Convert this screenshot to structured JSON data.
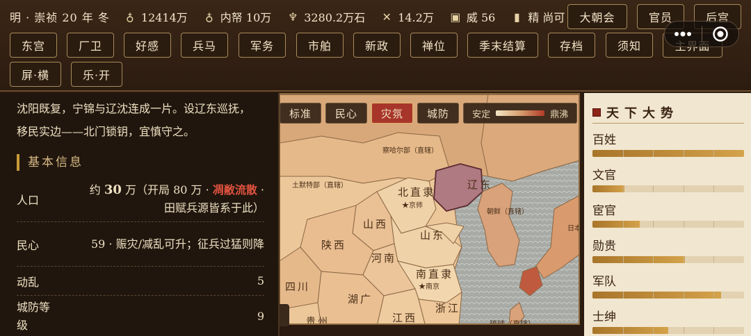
{
  "status": {
    "era": "明 · 崇祯 20 年 冬",
    "stats": [
      {
        "icon": "money-bag-icon",
        "glyph": "♁",
        "value": "12414万"
      },
      {
        "icon": "treasury-pouch-icon",
        "glyph": "♁",
        "value": "内帑 10万"
      },
      {
        "icon": "grain-icon",
        "glyph": "♆",
        "value": "3280.2万石"
      },
      {
        "icon": "crossed-swords-icon",
        "glyph": "✕",
        "value": "14.2万"
      },
      {
        "icon": "lock-icon",
        "glyph": "▣",
        "value": "威 56"
      },
      {
        "icon": "candle-icon",
        "glyph": "▮",
        "value": "精 尚可"
      }
    ]
  },
  "top_buttons": [
    "大朝会",
    "官员",
    "后宫"
  ],
  "nav_row1": [
    "东宫",
    "厂卫",
    "好感",
    "兵马",
    "军务",
    "市舶",
    "新政",
    "禅位",
    "季末结算",
    "存档",
    "须知",
    "主界面"
  ],
  "nav_row2": [
    "屏·横",
    "乐·开"
  ],
  "left": {
    "description": "沈阳既复，宁锦与辽沈连成一片。设辽东巡抚，移民实边——北门锁钥，宜慎守之。",
    "section_title": "基本信息",
    "rows": [
      {
        "key": "人口",
        "pre": "约 ",
        "num": "30",
        "mid": " 万（开局 80 万 · ",
        "red": "凋敝流散",
        "post": " · 田赋兵源皆系于此）"
      },
      {
        "key": "民心",
        "value": "59 · 赈灾/减乱可升；征兵过猛则降"
      },
      {
        "key": "动乱",
        "value": "5"
      },
      {
        "key": "城防等级",
        "value": "9"
      }
    ]
  },
  "map": {
    "tabs": [
      "标准",
      "民心",
      "灾氛",
      "城防"
    ],
    "active_tab": "灾氛",
    "legend_low": "安定",
    "legend_high": "鼎沸",
    "labels": [
      "察哈尔部（直辖）",
      "土默特部（直辖）",
      "北直隶",
      "★京师",
      "辽东",
      "朝鲜（直辖）",
      "山西",
      "山东",
      "陕西",
      "河南",
      "南直隶",
      "★南京",
      "四川",
      "湖广",
      "浙江",
      "贵州",
      "江西",
      "琉球（直辖）",
      "日本"
    ]
  },
  "right": {
    "title": "天下大势",
    "bars": [
      {
        "label": "百姓",
        "value": 1.0
      },
      {
        "label": "文官",
        "value": 0.21
      },
      {
        "label": "宦官",
        "value": 0.31
      },
      {
        "label": "勋贵",
        "value": 0.61
      },
      {
        "label": "军队",
        "value": 0.85
      },
      {
        "label": "士绅",
        "value": 0.5
      }
    ]
  },
  "colors": {
    "accent_red": "#a8352a",
    "liaodong": "#b07a82",
    "sea": "#a9aba6",
    "land": "#ecc79a"
  }
}
